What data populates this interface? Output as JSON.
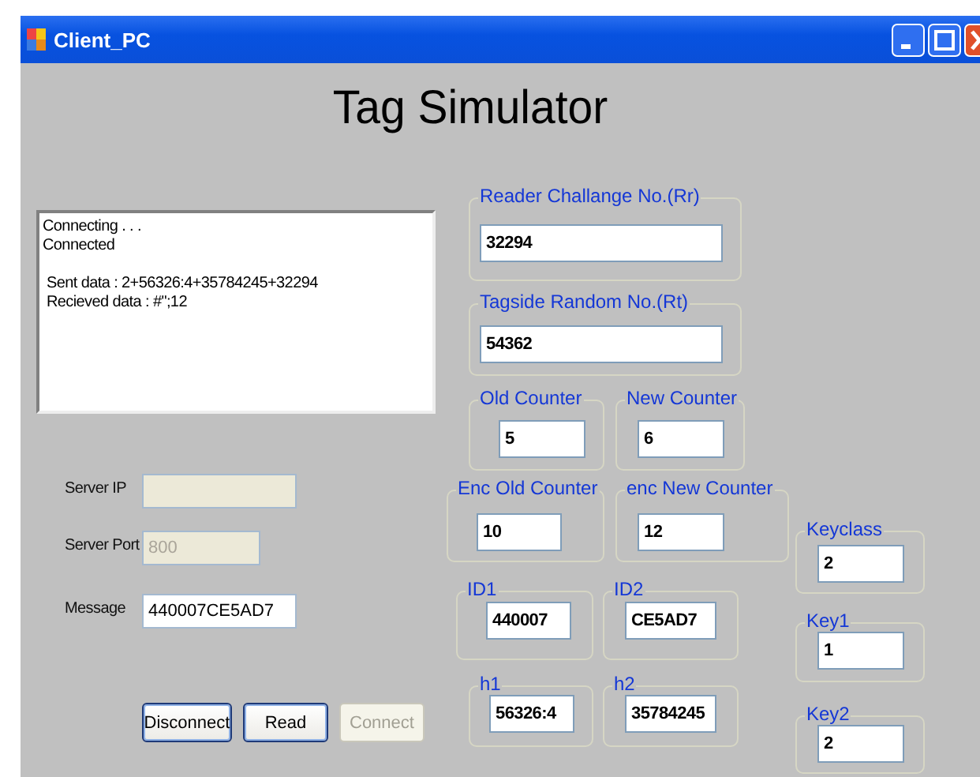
{
  "window": {
    "title": "Client_PC"
  },
  "heading": "Tag Simulator",
  "log": [
    [
      "Connecting . . .",
      "Connected"
    ],
    [
      " Sent data : 2+56326:4+35784245+32294",
      " Recieved data : #\";12"
    ]
  ],
  "connection_fields": [
    {
      "label": "Server IP",
      "disabled": true
    },
    {
      "label": "Server Port",
      "value": "800",
      "disabled": true
    },
    {
      "label": "Message",
      "value": "440007CE5AD7",
      "disabled": false
    }
  ],
  "buttons": [
    {
      "label": "Disconnect",
      "disabled": false
    },
    {
      "label": "Read",
      "disabled": false
    },
    {
      "label": "Connect",
      "disabled": true
    }
  ],
  "groups": [
    {
      "label": "Reader Challange No.(Rr)",
      "value": "32294"
    },
    {
      "label": "Tagside Random No.(Rt)",
      "value": "54362"
    },
    {
      "label": "Old Counter",
      "value": "5"
    },
    {
      "label": "New Counter",
      "value": "6"
    },
    {
      "label": "Enc Old Counter",
      "value": "10"
    },
    {
      "label": "enc New Counter",
      "value": "12"
    },
    {
      "label": "Keyclass",
      "value": "2"
    },
    {
      "label": "ID1",
      "value": "440007"
    },
    {
      "label": "ID2",
      "value": "CE5AD7"
    },
    {
      "label": "Key1",
      "value": "1"
    },
    {
      "label": "h1",
      "value": "56326:4"
    },
    {
      "label": "h2",
      "value": "35784245"
    },
    {
      "label": "Key2",
      "value": "2"
    }
  ]
}
